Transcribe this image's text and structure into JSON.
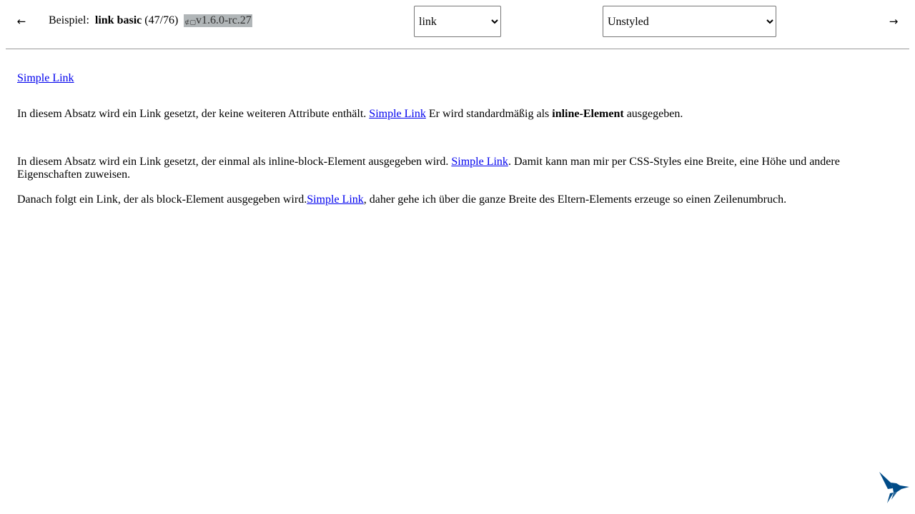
{
  "nav": {
    "prev_icon": "arrow-left-icon",
    "next_icon": "arrow-right-icon",
    "prev_glyph": "←",
    "next_glyph": "→"
  },
  "header": {
    "label": "Beispiel:",
    "name": "link basic",
    "counter": "(47/76)",
    "version_icon": "tag-icon",
    "version": "v1.6.0-rc.27"
  },
  "selects": {
    "component": {
      "value": "link",
      "options": [
        "link"
      ]
    },
    "theme": {
      "value": "Unstyled",
      "options": [
        "Unstyled"
      ]
    }
  },
  "content": {
    "p1": {
      "link": "Simple Link"
    },
    "p2": {
      "before": "In diesem Absatz wird ein Link gesetzt, der keine weiteren Attribute enthält. ",
      "link": "Simple Link",
      "middle": " Er wird standardmäßig als ",
      "bold": "inline-Element",
      "after": " ausgegeben."
    },
    "p3": {
      "before": "In diesem Absatz wird ein Link gesetzt, der einmal als inline-block-Element ausgegeben wird. ",
      "link": "Simple Link",
      "after": ". Damit kann man mir per CSS-Styles eine Breite, eine Höhe und andere Eigenschaften zuweisen."
    },
    "p4": {
      "before": "Danach folgt ein Link, der als block-Element ausgegeben wird.",
      "link": "Simple Link",
      "after": ", daher gehe ich über die ganze Breite des Eltern-Elements erzeuge so einen Zeilenumbruch."
    }
  },
  "logo": {
    "icon": "hummingbird-logo-icon",
    "color": "#004b87"
  }
}
